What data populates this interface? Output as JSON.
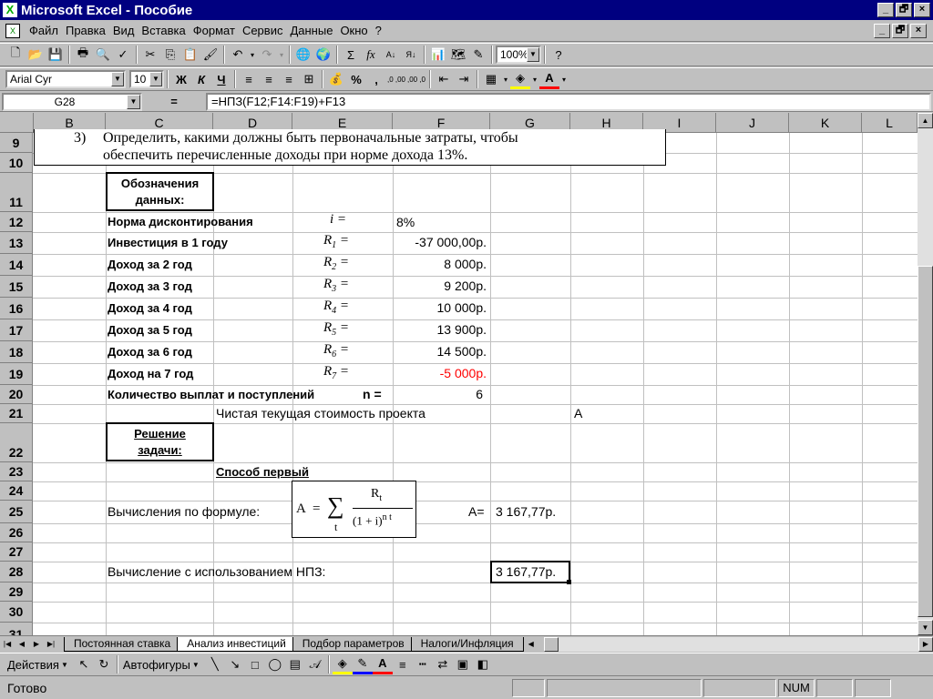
{
  "window": {
    "title": "Microsoft Excel - Пособие",
    "app_icon": "excel-x-icon",
    "controls": [
      "_",
      "🗗",
      "×"
    ]
  },
  "menu": {
    "items": [
      "Файл",
      "Правка",
      "Вид",
      "Вставка",
      "Формат",
      "Сервис",
      "Данные",
      "Окно",
      "?"
    ],
    "doc_controls": [
      "_",
      "🗗",
      "×"
    ]
  },
  "toolbar_standard": {
    "zoom": "100%",
    "buttons": [
      "new-icon",
      "open-icon",
      "save-icon",
      "print-icon",
      "print-preview-icon",
      "spelling-icon",
      "cut-icon",
      "copy-icon",
      "paste-icon",
      "format-painter-icon",
      "undo-icon",
      "redo-icon",
      "hyperlink-icon",
      "web-icon",
      "autosum-icon",
      "function-icon",
      "sort-asc-icon",
      "sort-desc-icon",
      "chart-wizard-icon",
      "map-icon",
      "drawing-icon",
      "help-icon"
    ]
  },
  "toolbar_format": {
    "font": "Arial Cyr",
    "size": "10",
    "bold": "Ж",
    "italic": "К",
    "underline": "Ч",
    "percent": "%",
    "comma": ",",
    "inc_dec": ",0 ,00",
    "dec_dec": ",00 ,0",
    "font_color_label": "A"
  },
  "formula_bar": {
    "name_box": "G28",
    "eq": "=",
    "formula": "=НПЗ(F12;F14:F19)+F13"
  },
  "columns": [
    "B",
    "C",
    "D",
    "E",
    "F",
    "G",
    "H",
    "I",
    "J",
    "K",
    "L"
  ],
  "rows": [
    "9",
    "10",
    "11",
    "12",
    "13",
    "14",
    "15",
    "16",
    "17",
    "18",
    "19",
    "20",
    "21",
    "22",
    "23",
    "24",
    "25",
    "26",
    "27",
    "28",
    "29",
    "30",
    "31"
  ],
  "sheet": {
    "task_number": "3)",
    "task_line1": "Определить, какими должны быть первоначальные затраты, чтобы",
    "task_line2": "обеспечить перечисленные доходы при норме дохода 13%.",
    "notation_header": "Обозначения данных:",
    "notation_l1": "Обозначения",
    "notation_l2": "данных:",
    "rows": [
      {
        "label": "Норма дисконтирования",
        "sym": "i =",
        "value": "8%"
      },
      {
        "label": "Инвестиция в 1 году",
        "sym": "R",
        "sub": "1",
        "eq": "=",
        "value": "-37 000,00р."
      },
      {
        "label": "Доход за 2 год",
        "sym": "R",
        "sub": "2",
        "eq": "=",
        "value": "8 000р."
      },
      {
        "label": "Доход за 3 год",
        "sym": "R",
        "sub": "3",
        "eq": "=",
        "value": "9 200р."
      },
      {
        "label": "Доход за 4 год",
        "sym": "R",
        "sub": "4",
        "eq": "=",
        "value": "10 000р."
      },
      {
        "label": "Доход за 5 год",
        "sym": "R",
        "sub": "5",
        "eq": "=",
        "value": "13 900р."
      },
      {
        "label": "Доход за 6 год",
        "sym": "R",
        "sub": "6",
        "eq": "=",
        "value": "14 500р."
      },
      {
        "label": "Доход на 7 год",
        "sym": "R",
        "sub": "7",
        "eq": "=",
        "value": "-5 000р."
      }
    ],
    "count_label": "Количество выплат и поступлений",
    "count_sym": "n =",
    "count_value": "6",
    "npv_title": "Чистая текущая стоимость проекта",
    "npv_symbol": "A",
    "solution_l1": "Решение",
    "solution_l2": "задачи:",
    "method1": "Способ первый",
    "calc_formula_label": "Вычисления по формуле:",
    "formula_A": "A",
    "formula_eq": "=",
    "formula_sum": "∑",
    "formula_t": "t",
    "formula_R": "R",
    "formula_Rsub": "t",
    "formula_den": "(1 + i)",
    "formula_exp": "n t",
    "result_label": "A=",
    "result_value": "3 167,77р.",
    "npz_label": "Вычисление с использованием НПЗ:",
    "npz_value": "3 167,77р."
  },
  "colors": {
    "negative_red": "#ff0000",
    "titlebar": "#000080"
  },
  "tabs": [
    "Постоянная ставка",
    "Анализ инвестиций",
    "Подбор параметров",
    "Налоги/Инфляция"
  ],
  "active_tab": "Анализ инвестиций",
  "drawing_toolbar": {
    "actions": "Действия",
    "autoshapes": "Автофигуры"
  },
  "status": {
    "text": "Готово",
    "num": "NUM"
  }
}
